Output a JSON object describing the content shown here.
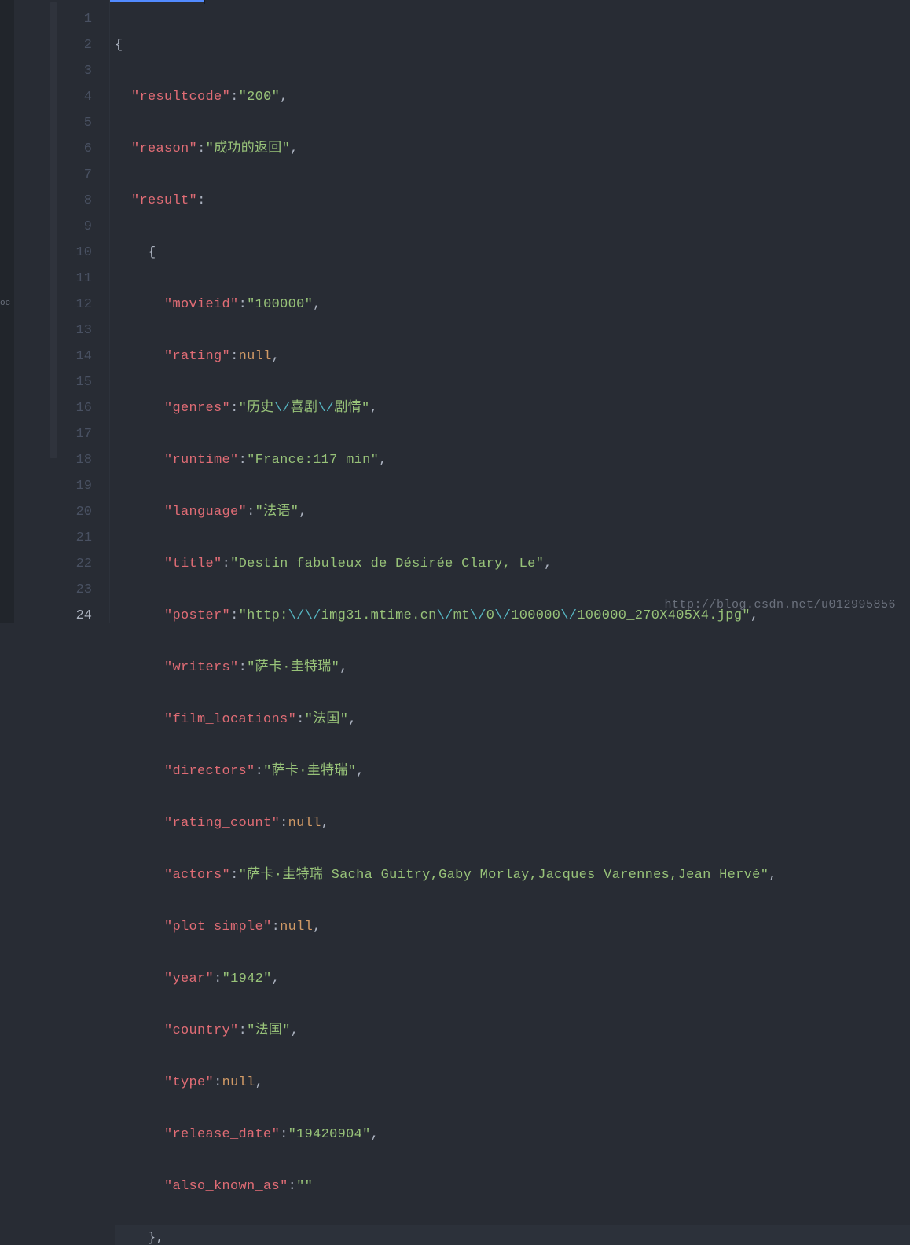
{
  "watermark": "http://blog.csdn.net/u012995856",
  "left_panel_label": "oc",
  "tokens": {
    "brace_open": "{",
    "brace_close": "},",
    "colon": ":",
    "comma": ",",
    "null": "null",
    "q": "\"",
    "esc_slash": "\\/"
  },
  "lines": {
    "l2_key": "resultcode",
    "l2_val": "200",
    "l3_key": "reason",
    "l3_val": "成功的返回",
    "l4_key": "result",
    "l6_key": "movieid",
    "l6_val": "100000",
    "l7_key": "rating",
    "l8_key": "genres",
    "l8_v1": "历史",
    "l8_v2": "喜剧",
    "l8_v3": "剧情",
    "l9_key": "runtime",
    "l9_val": "France:117 min",
    "l10_key": "language",
    "l10_val": "法语",
    "l11_key": "title",
    "l11_val": "Destin fabuleux de Désirée Clary, Le",
    "l12_key": "poster",
    "l12_p1": "http:",
    "l12_p2": "img31.mtime.cn",
    "l12_p3": "mt",
    "l12_p4": "0",
    "l12_p5": "100000",
    "l12_p6": "100000_270X405X4.jpg",
    "l13_key": "writers",
    "l13_val": "萨卡·圭特瑞",
    "l14_key": "film_locations",
    "l14_val": "法国",
    "l15_key": "directors",
    "l15_val": "萨卡·圭特瑞",
    "l16_key": "rating_count",
    "l17_key": "actors",
    "l17_val": "萨卡·圭特瑞 Sacha Guitry,Gaby Morlay,Jacques Varennes,Jean Hervé",
    "l18_key": "plot_simple",
    "l19_key": "year",
    "l19_val": "1942",
    "l20_key": "country",
    "l20_val": "法国",
    "l21_key": "type",
    "l22_key": "release_date",
    "l22_val": "19420904",
    "l23_key": "also_known_as",
    "l23_val": ""
  },
  "line_numbers": [
    "1",
    "2",
    "3",
    "4",
    "5",
    "6",
    "7",
    "8",
    "9",
    "10",
    "11",
    "12",
    "13",
    "14",
    "15",
    "16",
    "17",
    "18",
    "19",
    "20",
    "21",
    "22",
    "23",
    "24"
  ]
}
